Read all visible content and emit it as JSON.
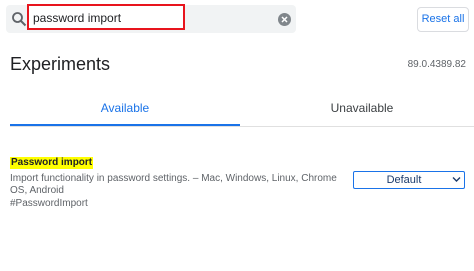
{
  "search": {
    "value": "password import",
    "icon": "search-icon",
    "clear_icon": "clear-icon"
  },
  "header": {
    "reset_label": "Reset all",
    "title": "Experiments",
    "version": "89.0.4389.82"
  },
  "tabs": [
    {
      "label": "Available",
      "active": true
    },
    {
      "label": "Unavailable",
      "active": false
    }
  ],
  "experiment": {
    "name": "Password import",
    "description": "Import functionality in password settings. – Mac, Windows, Linux, Chrome OS, Android",
    "link": "#PasswordImport",
    "selected_option": "Default"
  },
  "colors": {
    "accent": "#1a73e8",
    "highlight": "#ffff00",
    "annotation_red": "#e8141d"
  }
}
